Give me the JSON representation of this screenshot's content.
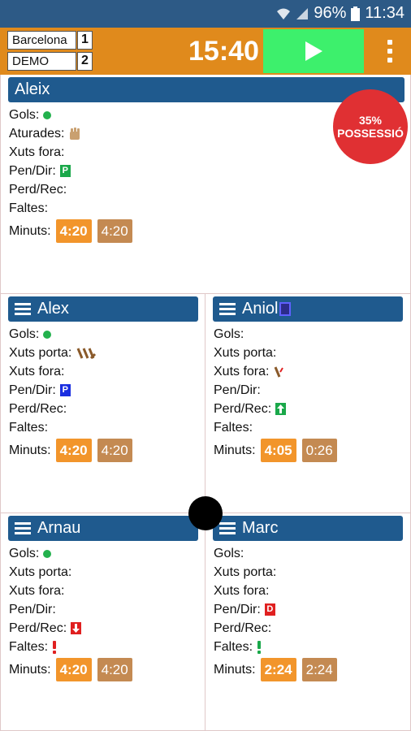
{
  "status_bar": {
    "battery": "96%",
    "time": "11:34"
  },
  "header": {
    "home_team": "Barcelona",
    "home_score": "1",
    "away_team": "DEMO",
    "away_score": "2",
    "timer": "15:40"
  },
  "possession": {
    "percent": "35%",
    "label": "POSSESSIÓ"
  },
  "players": [
    {
      "name": "Aleix",
      "stats": [
        "Gols:",
        "Aturades:",
        "Xuts fora:",
        "Pen/Dir:",
        "Perd/Rec:",
        "Faltes:"
      ],
      "minutes_label": "Minuts:",
      "minutes_a": "4:20",
      "minutes_b": "4:20",
      "pen_badge": "P"
    },
    {
      "name": "Alex",
      "stats": [
        "Gols:",
        "Xuts porta:",
        "Xuts fora:",
        "Pen/Dir:",
        "Perd/Rec:",
        "Faltes:"
      ],
      "minutes_label": "Minuts:",
      "minutes_a": "4:20",
      "minutes_b": "4:20",
      "pen_badge": "P"
    },
    {
      "name": "Aniol",
      "stats": [
        "Gols:",
        "Xuts porta:",
        "Xuts fora:",
        "Pen/Dir:",
        "Perd/Rec:",
        "Faltes:"
      ],
      "minutes_label": "Minuts:",
      "minutes_a": "4:05",
      "minutes_b": "0:26"
    },
    {
      "name": "Arnau",
      "stats": [
        "Gols:",
        "Xuts porta:",
        "Xuts fora:",
        "Pen/Dir:",
        "Perd/Rec:",
        "Faltes:"
      ],
      "minutes_label": "Minuts:",
      "minutes_a": "4:20",
      "minutes_b": "4:20"
    },
    {
      "name": "Marc",
      "stats": [
        "Gols:",
        "Xuts porta:",
        "Xuts fora:",
        "Pen/Dir:",
        "Perd/Rec:",
        "Faltes:"
      ],
      "minutes_label": "Minuts:",
      "minutes_a": "2:24",
      "minutes_b": "2:24",
      "dir_badge": "D"
    }
  ],
  "colors": {
    "status_bar": "#2d5a86",
    "header": "#e08a1c",
    "play": "#3df06c",
    "name_bar": "#1f5a8e",
    "goal_dot": "#23b14d",
    "minutes_active": "#f2952b",
    "minutes_total": "#c48a52",
    "possession": "#e03033"
  }
}
